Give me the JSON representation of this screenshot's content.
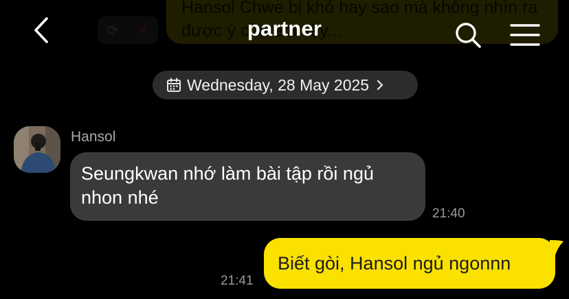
{
  "header": {
    "title": "partner",
    "back_icon": "chevron-left-icon",
    "search_icon": "search-icon",
    "menu_icon": "hamburger-menu-icon"
  },
  "background_preview": {
    "text": "Hansol Chwe bị khó hay sao mà không nhìn ra được ý của em vậy..."
  },
  "date_divider": {
    "icon": "calendar-icon",
    "label": "Wednesday, 28 May 2025"
  },
  "messages": [
    {
      "direction": "incoming",
      "sender": "Hansol",
      "text": "Seungkwan nhớ làm bài tập rồi ngủ nhon nhé",
      "time": "21:40"
    },
    {
      "direction": "outgoing",
      "text": "Biết gòi, Hansol ngủ ngonnn",
      "time": "21:41"
    }
  ],
  "colors": {
    "background": "#000000",
    "incoming_bubble": "#3a3a3c",
    "outgoing_bubble": "#fae100",
    "date_pill": "#2c2c2e",
    "timestamp": "#9a9a9e"
  }
}
